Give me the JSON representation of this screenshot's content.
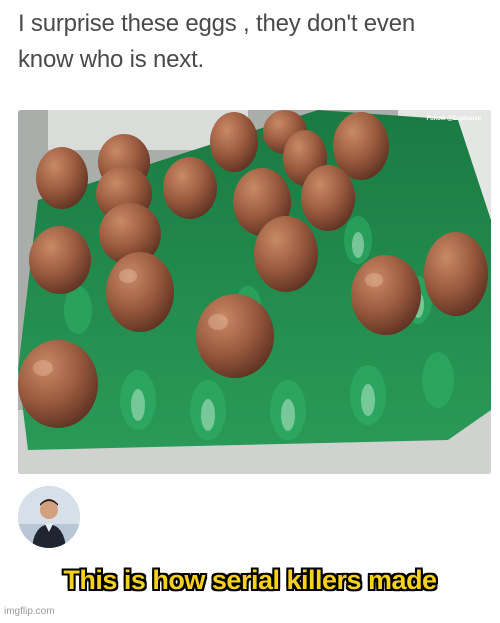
{
  "post": {
    "line1": "I surprise these eggs , they don't even",
    "line2": "know who is next."
  },
  "photo": {
    "watermark": "Follow @Explosive",
    "tray_color": "#1f8b4c",
    "egg_color": "#9a5a3e"
  },
  "meme": {
    "caption": "This is how serial killers made",
    "caption_color": "#f6d21c",
    "site": "imgflip.com"
  }
}
